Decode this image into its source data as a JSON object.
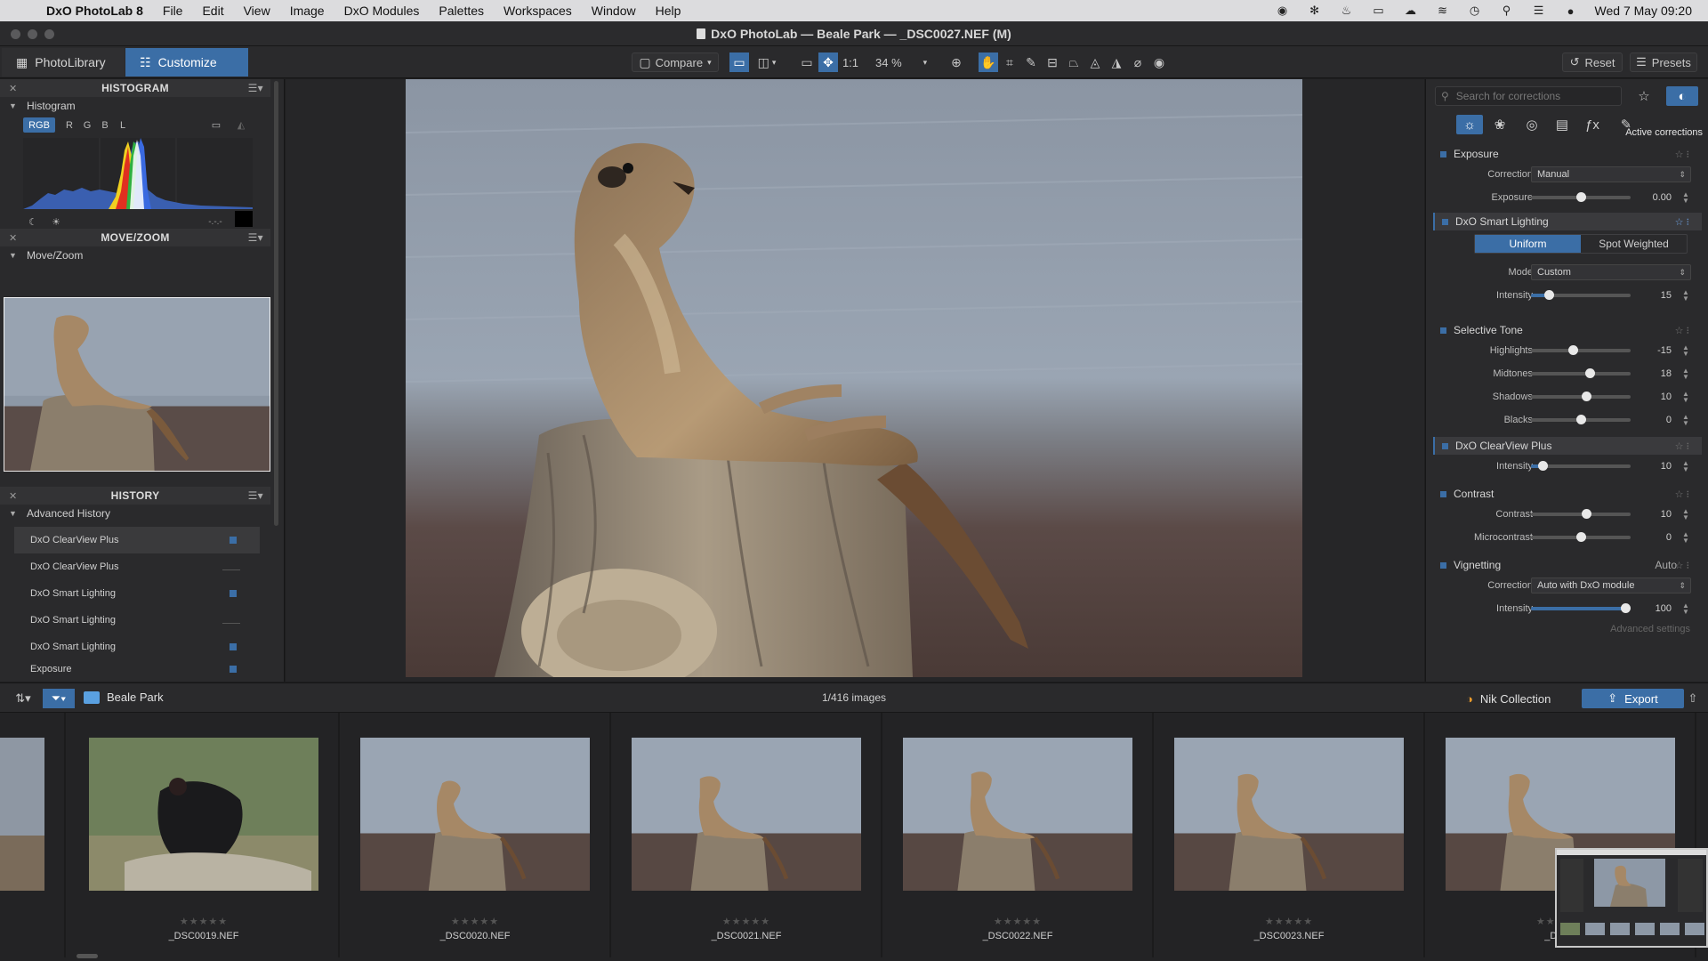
{
  "menubar": {
    "app": "DxO PhotoLab 8",
    "items": [
      "File",
      "Edit",
      "View",
      "Image",
      "DxO Modules",
      "Palettes",
      "Workspaces",
      "Window",
      "Help"
    ],
    "clock": "Wed 7 May  09:20"
  },
  "window": {
    "title": "DxO PhotoLab — Beale Park — _DSC0027.NEF (M)"
  },
  "toolbar": {
    "tab_library": "PhotoLibrary",
    "tab_customize": "Customize",
    "compare": "Compare",
    "one_to_one": "1:1",
    "zoom": "34 %",
    "reset": "Reset",
    "presets": "Presets"
  },
  "left": {
    "histogram_header": "HISTOGRAM",
    "histogram_sub": "Histogram",
    "channels": [
      "RGB",
      "R",
      "G",
      "B",
      "L"
    ],
    "histogram_readout": "-.-.-",
    "movezoom_header": "MOVE/ZOOM",
    "movezoom_sub": "Move/Zoom",
    "history_header": "HISTORY",
    "history_sub": "Advanced History",
    "history": [
      {
        "label": "DxO ClearView Plus",
        "on": true
      },
      {
        "label": "DxO ClearView Plus",
        "on": false
      },
      {
        "label": "DxO Smart Lighting",
        "on": true
      },
      {
        "label": "DxO Smart Lighting",
        "on": false
      },
      {
        "label": "DxO Smart Lighting",
        "on": true
      },
      {
        "label": "Exposure",
        "on": true
      }
    ]
  },
  "right": {
    "search_placeholder": "Search for corrections",
    "active_corrections": "Active corrections",
    "exposure": {
      "title": "Exposure",
      "correction_label": "Correction",
      "correction_value": "Manual",
      "exposure_label": "Exposure",
      "exposure_value": "0.00"
    },
    "smart_lighting": {
      "title": "DxO Smart Lighting",
      "uniform": "Uniform",
      "spot_weighted": "Spot Weighted",
      "mode_label": "Mode",
      "mode_value": "Custom",
      "intensity_label": "Intensity",
      "intensity_value": "15"
    },
    "selective_tone": {
      "title": "Selective Tone",
      "highlights_label": "Highlights",
      "highlights": "-15",
      "midtones_label": "Midtones",
      "midtones": "18",
      "shadows_label": "Shadows",
      "shadows": "10",
      "blacks_label": "Blacks",
      "blacks": "0"
    },
    "clearview": {
      "title": "DxO ClearView Plus",
      "intensity_label": "Intensity",
      "intensity_value": "10"
    },
    "contrast": {
      "title": "Contrast",
      "contrast_label": "Contrast",
      "contrast_value": "10",
      "micro_label": "Microcontrast",
      "micro_value": "0"
    },
    "vignetting": {
      "title": "Vignetting",
      "auto": "Auto",
      "correction_label": "Correction",
      "correction_value": "Auto with DxO module",
      "intensity_label": "Intensity",
      "intensity_value": "100"
    },
    "advanced_settings": "Advanced settings"
  },
  "filmbar": {
    "folder": "Beale Park",
    "count": "1/416 images",
    "nik": "Nik Collection",
    "export": "Export"
  },
  "filmstrip": {
    "stars": "★★★★★",
    "thumbs": [
      "_DSC0019.NEF",
      "_DSC0020.NEF",
      "_DSC0021.NEF",
      "_DSC0022.NEF",
      "_DSC0023.NEF",
      "_DSC0"
    ]
  },
  "colors": {
    "accent": "#3b6ea6",
    "panel": "#2a2a2c",
    "bg": "#1e1e1f"
  }
}
